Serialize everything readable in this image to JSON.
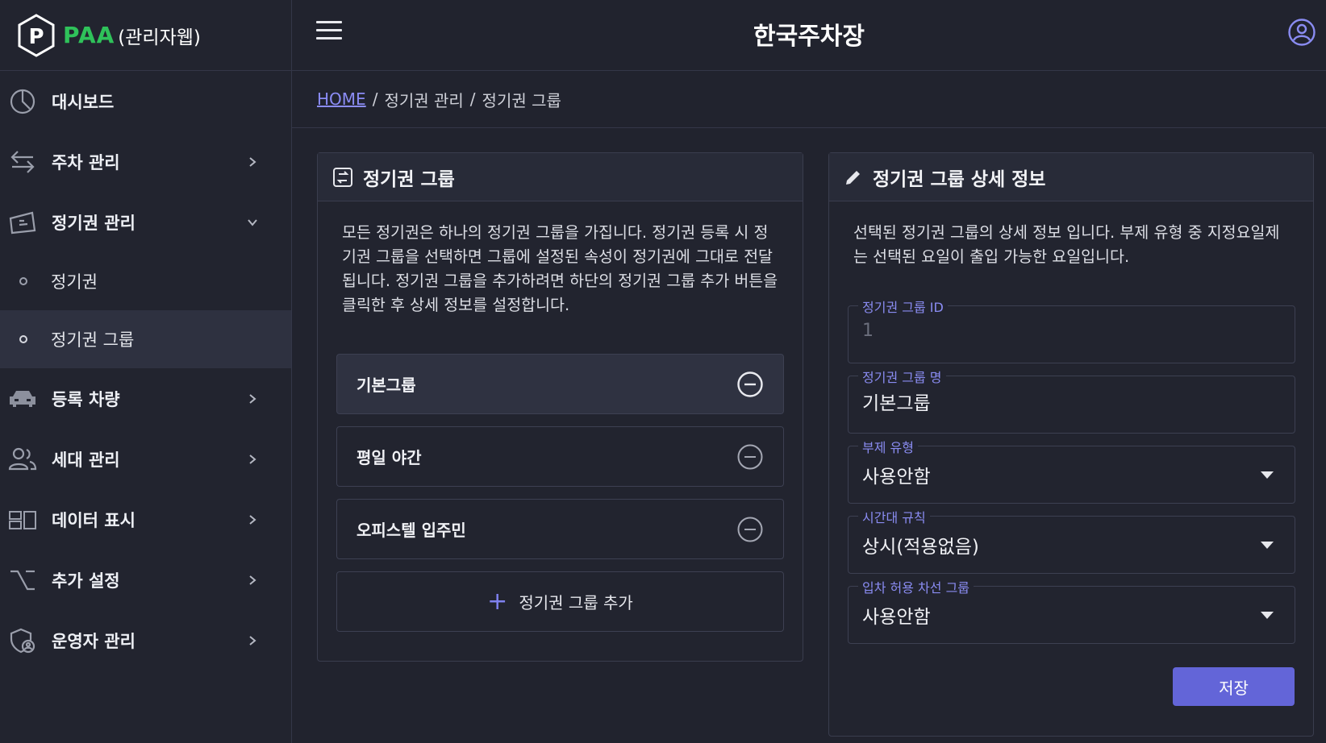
{
  "app": {
    "brand": "PAA",
    "brand_sub": "(관리자웹)",
    "logo_letter": "P",
    "title": "한국주차장"
  },
  "sidebar": {
    "items": [
      {
        "label": "대시보드",
        "icon": "dashboard-icon"
      },
      {
        "label": "주차 관리",
        "icon": "transfer-arrows-icon"
      },
      {
        "label": "정기권 관리",
        "icon": "ticket-icon",
        "expanded": true
      },
      {
        "label": "등록 차량",
        "icon": "car-icon"
      },
      {
        "label": "세대 관리",
        "icon": "people-icon"
      },
      {
        "label": "데이터 표시",
        "icon": "display-icon"
      },
      {
        "label": "추가 설정",
        "icon": "option-icon"
      },
      {
        "label": "운영자 관리",
        "icon": "admin-shield-icon"
      }
    ],
    "subitems": [
      {
        "label": "정기권",
        "active": false
      },
      {
        "label": "정기권 그룹",
        "active": true
      }
    ]
  },
  "breadcrumb": {
    "home": "HOME",
    "sep": "/",
    "level1": "정기권 관리",
    "level2": "정기권 그룹"
  },
  "left_panel": {
    "title": "정기권 그룹",
    "description": "모든 정기권은 하나의 정기권 그룹을 가집니다. 정기권 등록 시 정기권 그룹을 선택하면 그룹에 설정된 속성이 정기권에 그대로 전달됩니다. 정기권 그룹을 추가하려면 하단의 정기권 그룹 추가 버튼을 클릭한 후 상세 정보를 설정합니다.",
    "groups": [
      {
        "name": "기본그룹",
        "selected": true
      },
      {
        "name": "평일 야간",
        "selected": false
      },
      {
        "name": "오피스텔 입주민",
        "selected": false
      }
    ],
    "add_label": "정기권 그룹 추가",
    "add_symbol": "+"
  },
  "right_panel": {
    "title": "정기권 그룹 상세 정보",
    "description": "선택된 정기권 그룹의 상세 정보 입니다. 부제 유형 중 지정요일제는 선택된 요일이 출입 가능한 요일입니다.",
    "fields": {
      "group_id": {
        "label": "정기권 그룹 ID",
        "value": "1"
      },
      "group_name": {
        "label": "정기권 그룹 명",
        "value": "기본그룹"
      },
      "subtype": {
        "label": "부제 유형",
        "value": "사용안함"
      },
      "time_rule": {
        "label": "시간대 규칙",
        "value": "상시(적용없음)"
      },
      "lane_group": {
        "label": "입차 허용 차선 그룹",
        "value": "사용안함"
      }
    },
    "save_label": "저장"
  },
  "colors": {
    "accent": "#6365d8",
    "brand_green": "#2fc25a",
    "link": "#8b8cf5",
    "background": "#21232e"
  }
}
